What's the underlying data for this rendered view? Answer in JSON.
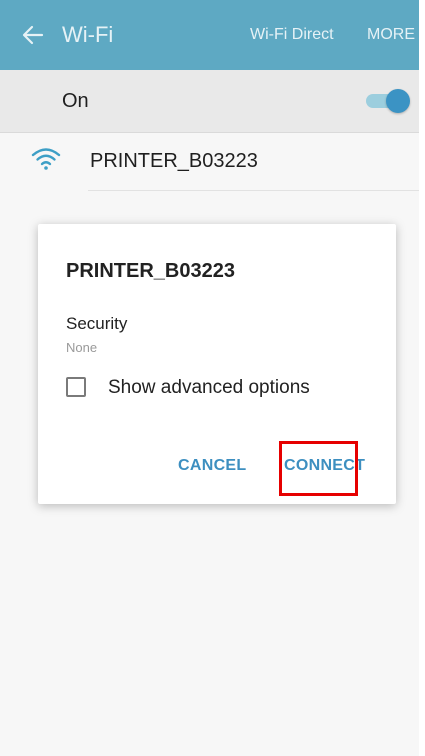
{
  "header": {
    "title": "Wi-Fi",
    "wifi_direct_label": "Wi-Fi Direct",
    "more_label": "MORE",
    "icons": {
      "back": "arrow-left-icon"
    }
  },
  "toggle_row": {
    "label": "On",
    "switch_on": true
  },
  "network": {
    "name": "PRINTER_B03223",
    "icon": "wifi-signal-icon"
  },
  "dialog": {
    "title": "PRINTER_B03223",
    "security_label": "Security",
    "security_value": "None",
    "advanced_label": "Show advanced options",
    "advanced_checked": false,
    "cancel_label": "CANCEL",
    "connect_label": "CONNECT"
  },
  "colors": {
    "header_bg": "#5ea9c3",
    "accent": "#3d8fc0",
    "switch_thumb": "#3b93c4",
    "highlight": "#e60000"
  }
}
